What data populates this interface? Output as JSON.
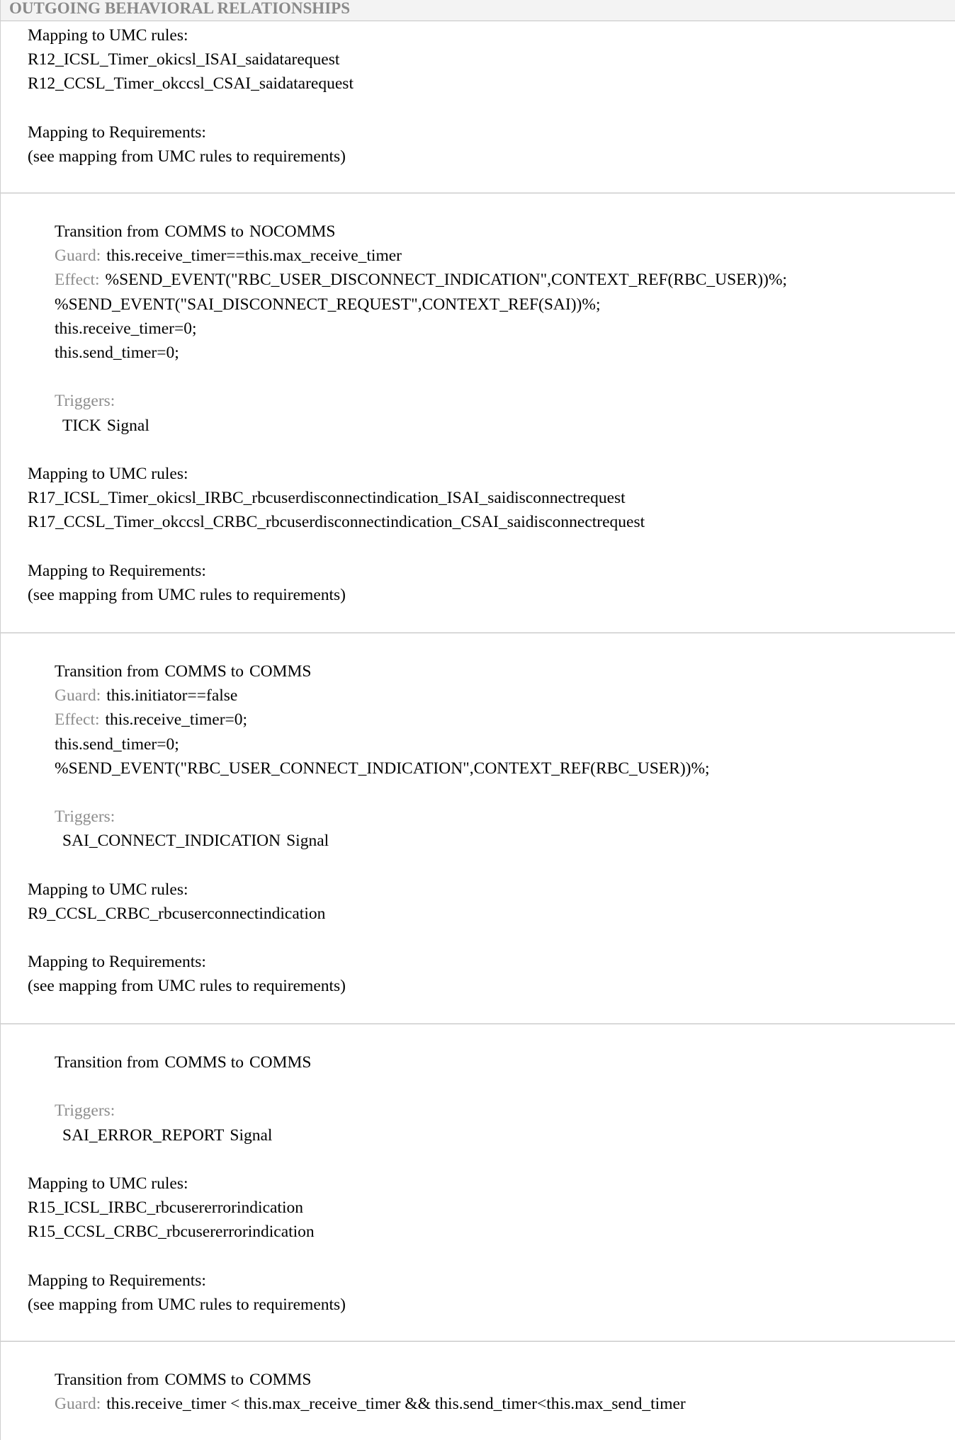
{
  "header": {
    "title": "OUTGOING BEHAVIORAL RELATIONSHIPS"
  },
  "common": {
    "umc_label": "Mapping to UMC rules:",
    "req_label": "Mapping to Requirements:",
    "req_text": "(see mapping from UMC rules to requirements)",
    "guard_label": "Guard:",
    "effect_label": "Effect:",
    "triggers_label": "Triggers:",
    "transition_prefix": "Transition from",
    "transition_to": "to",
    "signal_suffix": "Signal"
  },
  "section0": {
    "umc_rules": [
      "R12_ICSL_Timer_okicsl_ISAI_saidatarequest",
      "R12_CCSL_Timer_okccsl_CSAI_saidatarequest"
    ]
  },
  "transitions": [
    {
      "from": "COMMS",
      "to": "NOCOMMS",
      "guard": "this.receive_timer==this.max_receive_timer",
      "effect": [
        "%SEND_EVENT(\"RBC_USER_DISCONNECT_INDICATION\",CONTEXT_REF(RBC_USER))%;",
        "%SEND_EVENT(\"SAI_DISCONNECT_REQUEST\",CONTEXT_REF(SAI))%;",
        "this.receive_timer=0;",
        "this.send_timer=0;"
      ],
      "trigger": "TICK",
      "umc_rules": [
        "R17_ICSL_Timer_okicsl_IRBC_rbcuserdisconnectindication_ISAI_saidisconnectrequest",
        "R17_CCSL_Timer_okccsl_CRBC_rbcuserdisconnectindication_CSAI_saidisconnectrequest"
      ]
    },
    {
      "from": "COMMS",
      "to": "COMMS",
      "guard": "this.initiator==false",
      "effect": [
        "this.receive_timer=0;",
        "this.send_timer=0;",
        "%SEND_EVENT(\"RBC_USER_CONNECT_INDICATION\",CONTEXT_REF(RBC_USER))%;"
      ],
      "trigger": "SAI_CONNECT_INDICATION",
      "umc_rules": [
        "R9_CCSL_CRBC_rbcuserconnectindication"
      ]
    },
    {
      "from": "COMMS",
      "to": "COMMS",
      "trigger": "SAI_ERROR_REPORT",
      "umc_rules": [
        "R15_ICSL_IRBC_rbcusererrorindication",
        "R15_CCSL_CRBC_rbcusererrorindication"
      ]
    },
    {
      "from": "COMMS",
      "to": "COMMS",
      "guard": "this.receive_timer < this.max_receive_timer && this.send_timer<this.max_send_timer"
    }
  ]
}
